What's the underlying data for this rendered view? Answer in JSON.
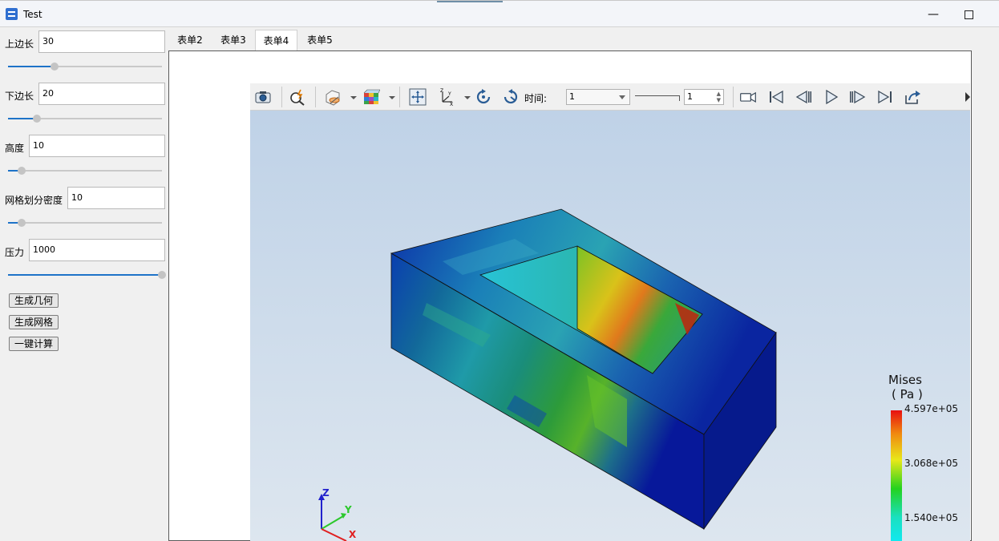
{
  "window": {
    "title": "Test"
  },
  "params": [
    {
      "label": "上边长",
      "value": "30",
      "slider": 0.3
    },
    {
      "label": "下边长",
      "value": "20",
      "slider": 0.19
    },
    {
      "label": "高度",
      "value": "10",
      "slider": 0.09
    },
    {
      "label": "网格划分密度",
      "value": "10",
      "slider": 0.09
    },
    {
      "label": "压力",
      "value": "1000",
      "slider": 1.0
    }
  ],
  "buttons": {
    "gen_geometry": "生成几何",
    "gen_mesh": "生成网格",
    "compute": "一键计算"
  },
  "tabs": [
    "表单2",
    "表单3",
    "表单4",
    "表单5"
  ],
  "active_tab": "表单4",
  "toolbar": {
    "time_label": "时间:",
    "time_value": "1",
    "step_value": "1"
  },
  "legend": {
    "title": "Mises",
    "unit": "( Pa )",
    "max": "4.597e+05",
    "mid": "3.068e+05",
    "low": "1.540e+05"
  },
  "axes": {
    "z": "Z",
    "y": "Y",
    "x": "X"
  },
  "colors": {
    "accent": "#1e73c8",
    "mesh_dark": "#061a8c"
  }
}
